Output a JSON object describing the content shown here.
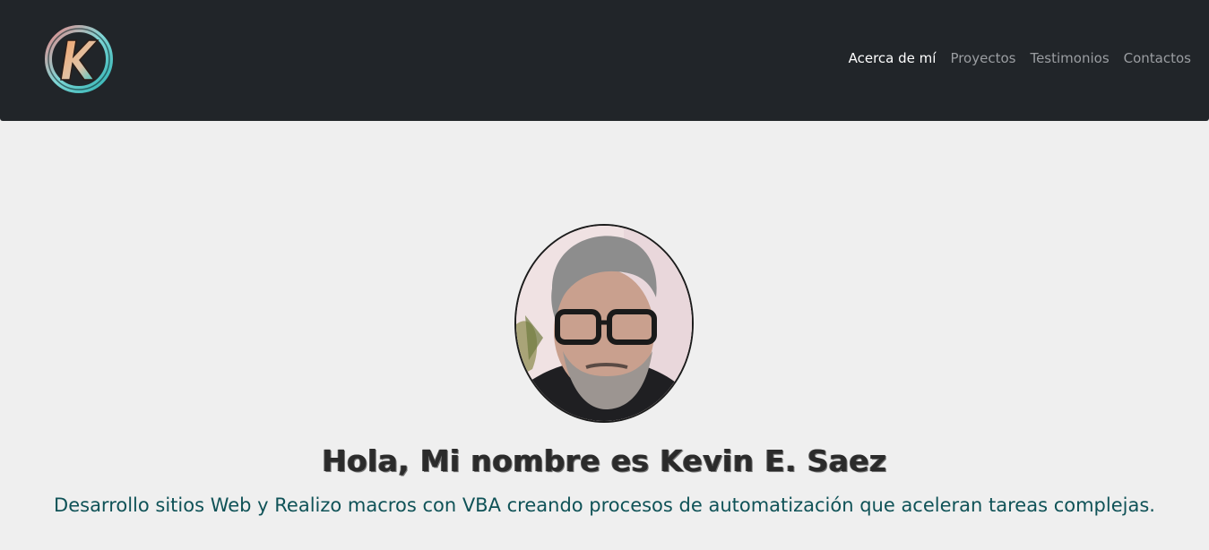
{
  "nav": {
    "logo_letter": "K",
    "links": [
      {
        "label": "Acerca de mí",
        "active": true
      },
      {
        "label": "Proyectos",
        "active": false
      },
      {
        "label": "Testimonios",
        "active": false
      },
      {
        "label": "Contactos",
        "active": false
      }
    ]
  },
  "hero": {
    "title": "Hola, Mi nombre es Kevin E. Saez",
    "subtitle": "Desarrollo sitios Web y Realizo macros con VBA creando procesos de automatización que aceleran tareas complejas."
  },
  "colors": {
    "navbar_bg": "#212529",
    "page_bg": "#efefef",
    "subtitle": "#0f5257",
    "nav_active": "#ffffff",
    "nav_inactive": "#9a9da1"
  }
}
